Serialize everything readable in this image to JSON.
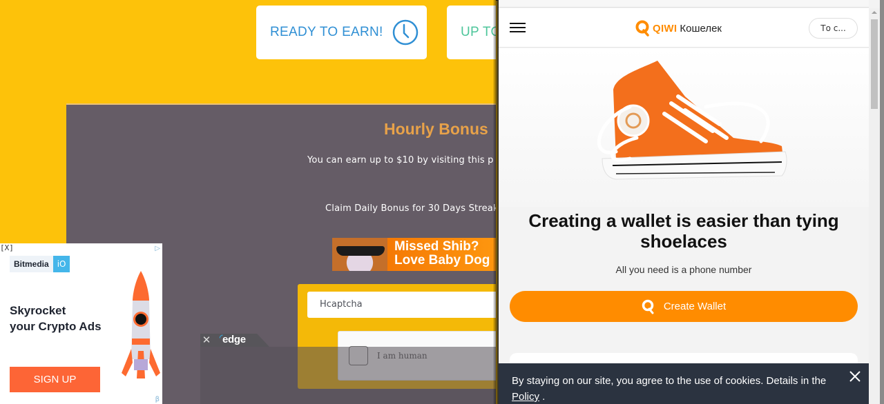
{
  "faucet": {
    "stat_cards": [
      {
        "label": "READY TO EARN!",
        "icon": "clock-icon"
      },
      {
        "label": "UP TO"
      }
    ],
    "bonus_title": "Hourly Bonus",
    "bonus_subtitle": "You can earn up to $10 by visiting this p",
    "streak_text": "Claim Daily Bonus for 30 Days Streak",
    "banner_ad": {
      "line1": "Missed Shib?",
      "line2": "Love Baby Dog"
    },
    "captcha_select_value": "Hcaptcha",
    "captcha_label": "I am human",
    "colors": {
      "background": "#fdc20a",
      "panel": "#655c66",
      "title": "#e8a249"
    }
  },
  "edge_overlay": {
    "close_icon": "close-icon",
    "logo_text": "edge"
  },
  "bitmedia_ad": {
    "close_label": "[X]",
    "adchoices_icon": "adchoices-icon",
    "logo_name": "Bitmedia",
    "logo_suffix": "iO",
    "headline_line1": "Skyrocket",
    "headline_line2": "your Crypto Ads",
    "cta_label": "SIGN UP",
    "beta_mark": "β"
  },
  "qiwi": {
    "menu_icon": "hamburger-icon",
    "brand": "QIWI",
    "brand_suffix": "Кошелек",
    "lang_button": "То с...",
    "hero_title_line1": "Creating a wallet is easier than tying",
    "hero_title_line2": "shoelaces",
    "hero_subtitle": "All you need is a phone number",
    "create_button": "Create Wallet",
    "cookie_text": "By staying on our site, you agree to the use of cookies. Details in the",
    "cookie_link": "Policy",
    "cookie_suffix": " .",
    "colors": {
      "accent": "#ff8c00",
      "cookie_bg": "#2b3340"
    }
  }
}
